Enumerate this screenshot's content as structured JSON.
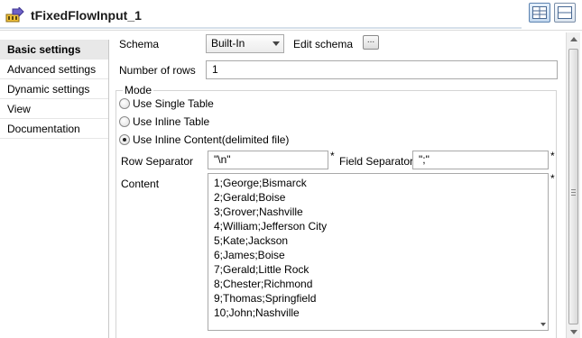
{
  "header": {
    "title": "tFixedFlowInput_1",
    "icon": "fixed-flow-input-icon"
  },
  "sidebar": {
    "items": [
      {
        "label": "Basic settings",
        "active": true
      },
      {
        "label": "Advanced settings",
        "active": false
      },
      {
        "label": "Dynamic settings",
        "active": false
      },
      {
        "label": "View",
        "active": false
      },
      {
        "label": "Documentation",
        "active": false
      }
    ]
  },
  "main": {
    "schema_label": "Schema",
    "schema_value": "Built-In",
    "edit_schema_label": "Edit schema",
    "edit_schema_button": "...",
    "rows_label": "Number of rows",
    "rows_value": "1",
    "mode_label": "Mode",
    "mode_options": [
      {
        "label": "Use Single Table",
        "checked": false
      },
      {
        "label": "Use Inline Table",
        "checked": false
      },
      {
        "label": "Use Inline Content(delimited file)",
        "checked": true
      }
    ],
    "row_separator_label": "Row Separator",
    "row_separator_value": "\"\\n\"",
    "field_separator_label": "Field Separator",
    "field_separator_value": "\";\"",
    "required_mark": "*",
    "content_label": "Content",
    "content_lines": [
      "1;George;Bismarck",
      "2;Gerald;Boise",
      "3;Grover;Nashville",
      "4;William;Jefferson City",
      "5;Kate;Jackson",
      "6;James;Boise",
      "7;Gerald;Little Rock",
      "8;Chester;Richmond",
      "9;Thomas;Springfield",
      "10;John;Nashville"
    ]
  },
  "colors": {
    "active_sidebar_bg": "#e8e8e8",
    "border": "#a9a9a9",
    "view_button_border": "#5b82b0"
  }
}
